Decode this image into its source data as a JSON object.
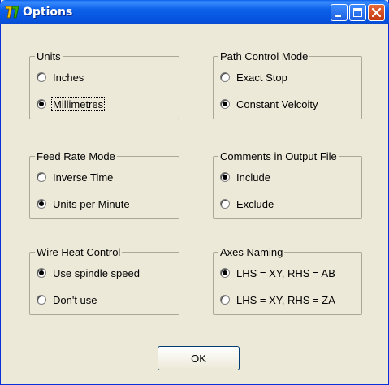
{
  "window": {
    "title": "Options"
  },
  "groups": [
    {
      "legend": "Units",
      "options": [
        {
          "label": "Inches",
          "checked": false
        },
        {
          "label": "Millimetres",
          "checked": true,
          "focused": true
        }
      ]
    },
    {
      "legend": "Path Control Mode",
      "options": [
        {
          "label": "Exact Stop",
          "checked": false
        },
        {
          "label": "Constant Velcoity",
          "checked": true
        }
      ]
    },
    {
      "legend": "Feed Rate Mode",
      "options": [
        {
          "label": "Inverse Time",
          "checked": false
        },
        {
          "label": "Units per Minute",
          "checked": true
        }
      ]
    },
    {
      "legend": "Comments in Output File",
      "options": [
        {
          "label": "Include",
          "checked": true
        },
        {
          "label": "Exclude",
          "checked": false
        }
      ]
    },
    {
      "legend": "Wire Heat Control",
      "options": [
        {
          "label": "Use spindle speed",
          "checked": true
        },
        {
          "label": "Don't use",
          "checked": false
        }
      ]
    },
    {
      "legend": "Axes Naming",
      "options": [
        {
          "label": "LHS = XY, RHS = AB",
          "checked": true
        },
        {
          "label": "LHS = XY, RHS = ZA",
          "checked": false
        }
      ]
    }
  ],
  "ok_label": "OK"
}
